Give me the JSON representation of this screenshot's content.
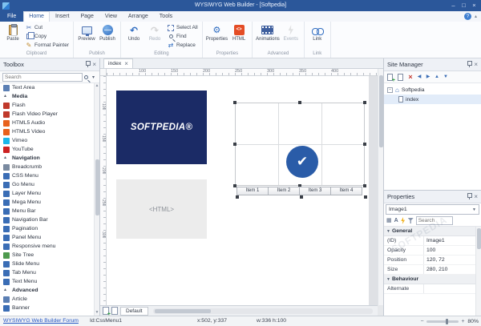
{
  "titlebar": {
    "title": "WYSIWYG Web Builder - [Softpedia]"
  },
  "menu": {
    "tabs": [
      {
        "label": "File",
        "cls": "file"
      },
      {
        "label": "Home",
        "cls": "active"
      },
      {
        "label": "Insert",
        "cls": ""
      },
      {
        "label": "Page",
        "cls": ""
      },
      {
        "label": "View",
        "cls": ""
      },
      {
        "label": "Arrange",
        "cls": ""
      },
      {
        "label": "Tools",
        "cls": ""
      }
    ]
  },
  "ribbon": {
    "clipboard": {
      "label": "Clipboard",
      "paste": "Paste",
      "cut": "Cut",
      "copy": "Copy",
      "format_painter": "Format Painter"
    },
    "publish": {
      "label": "Publish",
      "preview": "Preview",
      "publish": "Publish"
    },
    "editing": {
      "label": "Editing",
      "undo": "Undo",
      "redo": "Redo",
      "select_all": "Select All",
      "find": "Find",
      "replace": "Replace"
    },
    "properties": {
      "label": "Properties",
      "properties": "Properties",
      "html": "HTML"
    },
    "advanced": {
      "label": "Advanced",
      "animations": "Animations",
      "events": "Events"
    },
    "link": {
      "label": "Link",
      "link": "Link"
    }
  },
  "toolbox": {
    "title": "Toolbox",
    "search_placeholder": "Search",
    "items": [
      {
        "label": "Text Area",
        "kind": "item",
        "color": "#5b7fb4"
      },
      {
        "label": "Media",
        "kind": "section",
        "color": ""
      },
      {
        "label": "Flash",
        "kind": "item",
        "color": "#c0392b"
      },
      {
        "label": "Flash Video Player",
        "kind": "item",
        "color": "#c0392b"
      },
      {
        "label": "HTML5 Audio",
        "kind": "item",
        "color": "#e8611c"
      },
      {
        "label": "HTML5 Video",
        "kind": "item",
        "color": "#e8611c"
      },
      {
        "label": "Vimeo",
        "kind": "item",
        "color": "#1ab7ea"
      },
      {
        "label": "YouTube",
        "kind": "item",
        "color": "#cc2222"
      },
      {
        "label": "Navigation",
        "kind": "section",
        "color": ""
      },
      {
        "label": "Breadcrumb",
        "kind": "item",
        "color": "#7a8aa0"
      },
      {
        "label": "CSS Menu",
        "kind": "item",
        "color": "#3a6db5"
      },
      {
        "label": "Go Menu",
        "kind": "item",
        "color": "#3a6db5"
      },
      {
        "label": "Layer Menu",
        "kind": "item",
        "color": "#3a6db5"
      },
      {
        "label": "Mega Menu",
        "kind": "item",
        "color": "#3a6db5"
      },
      {
        "label": "Menu Bar",
        "kind": "item",
        "color": "#3a6db5"
      },
      {
        "label": "Navigation Bar",
        "kind": "item",
        "color": "#3a6db5"
      },
      {
        "label": "Pagination",
        "kind": "item",
        "color": "#3a6db5"
      },
      {
        "label": "Panel Menu",
        "kind": "item",
        "color": "#3a6db5"
      },
      {
        "label": "Responsive menu",
        "kind": "item",
        "color": "#3a6db5"
      },
      {
        "label": "Site Tree",
        "kind": "item",
        "color": "#4e9a4e"
      },
      {
        "label": "Slide Menu",
        "kind": "item",
        "color": "#3a6db5"
      },
      {
        "label": "Tab Menu",
        "kind": "item",
        "color": "#3a6db5"
      },
      {
        "label": "Text Menu",
        "kind": "item",
        "color": "#3a6db5"
      },
      {
        "label": "Advanced",
        "kind": "section",
        "color": ""
      },
      {
        "label": "Article",
        "kind": "item",
        "color": "#5b7fb4"
      },
      {
        "label": "Banner",
        "kind": "item",
        "color": "#3a6db5"
      }
    ]
  },
  "canvas": {
    "tab": "index",
    "ruler_h": [
      "100",
      "150",
      "200",
      "250",
      "300",
      "350",
      "400"
    ],
    "ruler_v": [
      "100",
      "150",
      "200",
      "250",
      "300"
    ],
    "logo_text": "SOFTPEDIA®",
    "html_placeholder": "<HTML>",
    "items": [
      "Item 1",
      "Item 2",
      "Item 3",
      "Item 4"
    ],
    "page_tab": "Default"
  },
  "site_manager": {
    "title": "Site Manager",
    "root": "Softpedia",
    "child": "index"
  },
  "properties_panel": {
    "title": "Properties",
    "object": "Image1",
    "search_placeholder": "Search",
    "categories": [
      {
        "name": "General",
        "rows": [
          [
            "(ID)",
            "Image1"
          ],
          [
            "Opacity",
            "100"
          ],
          [
            "Position",
            "120, 72"
          ],
          [
            "Size",
            "280, 210"
          ]
        ]
      },
      {
        "name": "Behaviour",
        "rows": [
          [
            "Alternate",
            ""
          ]
        ]
      }
    ]
  },
  "statusbar": {
    "link": "WYSIWYG Web Builder Forum",
    "id": "Id:CssMenu1",
    "coords": "x:502, y:337",
    "size": "w:336 h:100",
    "zoom": "80%"
  },
  "watermark": "SOFTPEDIA",
  "colors": {
    "titlebar": "#2b579a",
    "accent": "#2b579a",
    "logo_bg": "#1b2b66",
    "check_circle": "#2a5ca8",
    "link": "#2456c4",
    "html_icon": "#e44d26"
  },
  "icons": {
    "titlebar": [
      "minimize",
      "restore",
      "close"
    ],
    "panel_header": [
      "pin",
      "close"
    ],
    "ribbon": {
      "paste": "clipboard",
      "cut": "scissors",
      "copy": "pages",
      "format_painter": "brush",
      "preview": "monitor",
      "publish": "globe",
      "undo": "arrow-undo",
      "redo": "arrow-redo",
      "select_all": "selection-box",
      "find": "magnifier",
      "replace": "swap-arrows",
      "properties": "wrench",
      "html": "html-tag",
      "animations": "filmstrip",
      "events": "lightning",
      "link": "chain"
    },
    "site_manager_toolbar": [
      "new-page",
      "clone-page",
      "delete-page",
      "move-left",
      "move-right",
      "move-up",
      "move-down"
    ],
    "properties_toolbar": [
      "categorized",
      "alphabetical",
      "events",
      "filter"
    ]
  }
}
